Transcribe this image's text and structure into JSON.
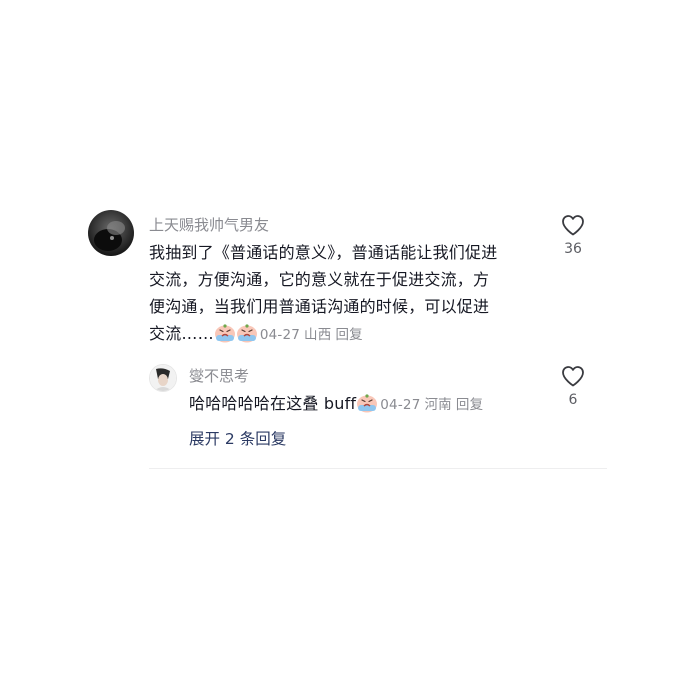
{
  "top_comment": {
    "username": "上天赐我帅气男友",
    "text_lines": [
      "我抽到了《普通话的意义》，普通话能让我们促进",
      "交流，方便沟通，它的意义就在于促进交流，方",
      "便沟通，当我们用普通话沟通的时候，可以促进",
      "交流……"
    ],
    "emojis": [
      "crying-emoji",
      "crying-emoji"
    ],
    "date": "04-27",
    "location": "山西",
    "reply_label": "回复",
    "like_count": "36"
  },
  "reply_comment": {
    "username": "燮不思考",
    "text": "哈哈哈哈哈在这叠 buff",
    "emojis": [
      "crying-emoji"
    ],
    "date": "04-27",
    "location": "河南",
    "reply_label": "回复",
    "like_count": "6"
  },
  "expand_replies_label": "展开 2 条回复"
}
